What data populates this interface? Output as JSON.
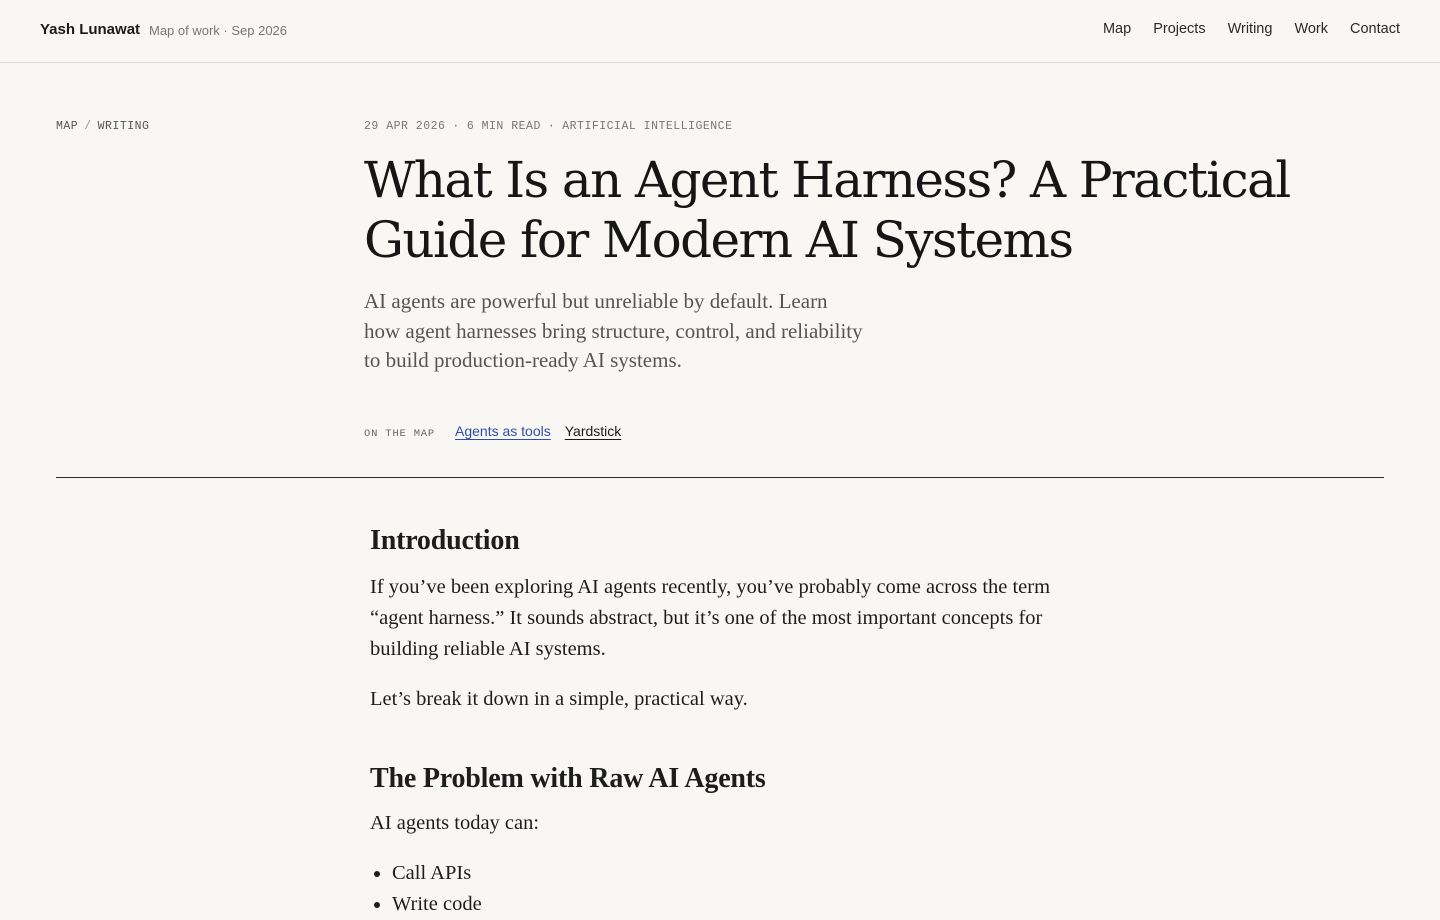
{
  "header": {
    "brand": "Yash Lunawat",
    "subtitle": "Map of work · Sep 2026",
    "nav": [
      "Map",
      "Projects",
      "Writing",
      "Work",
      "Contact"
    ]
  },
  "breadcrumb": {
    "items": [
      "Map",
      "Writing"
    ],
    "separator": "/"
  },
  "article": {
    "meta": {
      "date": "29 Apr 2026",
      "read_time": "6 min read",
      "category": "Artificial Intelligence",
      "separator": "·"
    },
    "title": "What Is an Agent Harness? A Practical Guide for Modern AI Systems",
    "dek": "AI agents are powerful but unreliable by default. Learn how agent harnesses bring structure, control, and reliability to build production-ready AI systems.",
    "on_the_map": {
      "label": "On the map",
      "links": [
        "Agents as tools",
        "Yardstick"
      ]
    },
    "sections": {
      "intro_heading": "Introduction",
      "intro_p1": "If you’ve been exploring AI agents recently, you’ve probably come across the term “agent harness.” It sounds abstract, but it’s one of the most important concepts for building reliable AI systems.",
      "intro_p2": "Let’s break it down in a simple, practical way.",
      "problem_heading": "The Problem with Raw AI Agents",
      "problem_p1": "AI agents today can:",
      "problem_list": [
        "Call APIs",
        "Write code"
      ]
    }
  },
  "colors": {
    "background": "#f8f7f3",
    "text": "#1c1c1c",
    "link_accent": "#2f4ea8",
    "muted": "#777777"
  }
}
